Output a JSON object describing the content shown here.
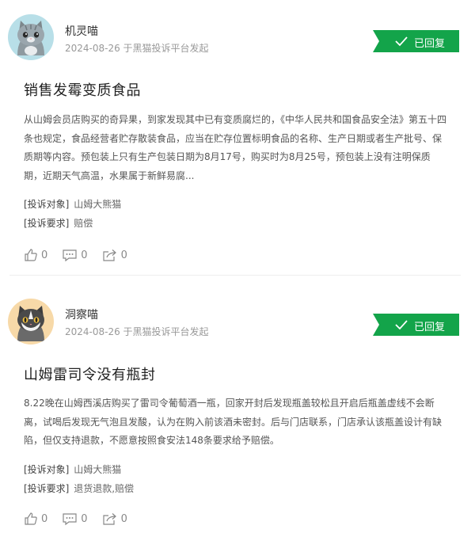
{
  "posts": [
    {
      "user": {
        "name": "机灵喵",
        "avatar_icon": "gray-cat-avatar"
      },
      "meta": "2024-08-26 于黑猫投诉平台发起",
      "status": "已回复",
      "title": "销售发霉变质食品",
      "content": "从山姆会员店购买的奇异果，到家发现其中已有变质腐烂的，《中华人民共和国食品安全法》第五十四条也规定，食品经营者贮存散装食品，应当在贮存位置标明食品的名称、生产日期或者生产批号、保质期等内容。预包装上只有生产包装日期为8月17号，购买时为8月25号，预包装上没有注明保质期，近期天气高温，水果属于新鲜易腐...",
      "target_label": "[投诉对象]",
      "target_value": "山姆大熊猫",
      "demand_label": "[投诉要求]",
      "demand_value": "赔偿",
      "likes": "0",
      "comments": "0",
      "shares": "0"
    },
    {
      "user": {
        "name": "洞察喵",
        "avatar_icon": "brown-cat-avatar"
      },
      "meta": "2024-08-26 于黑猫投诉平台发起",
      "status": "已回复",
      "title": "山姆雷司令没有瓶封",
      "content": "8.22晚在山姆西溪店购买了雷司令葡萄酒一瓶，回家开封后发现瓶盖较松且开启后瓶盖虚线不会断离，试喝后发现无气泡且发酸，认为在购入前该酒未密封。后与门店联系，门店承认该瓶盖设计有缺陷，但仅支持退款，不愿意按照食安法148条要求给予赔偿。",
      "target_label": "[投诉对象]",
      "target_value": "山姆大熊猫",
      "demand_label": "[投诉要求]",
      "demand_value": "退货退款,赔偿",
      "likes": "0",
      "comments": "0",
      "shares": "0"
    }
  ],
  "colors": {
    "badge": "#13a44a",
    "gray_cat": "#9aa6ad",
    "brown_cat": "#e7a45a"
  }
}
